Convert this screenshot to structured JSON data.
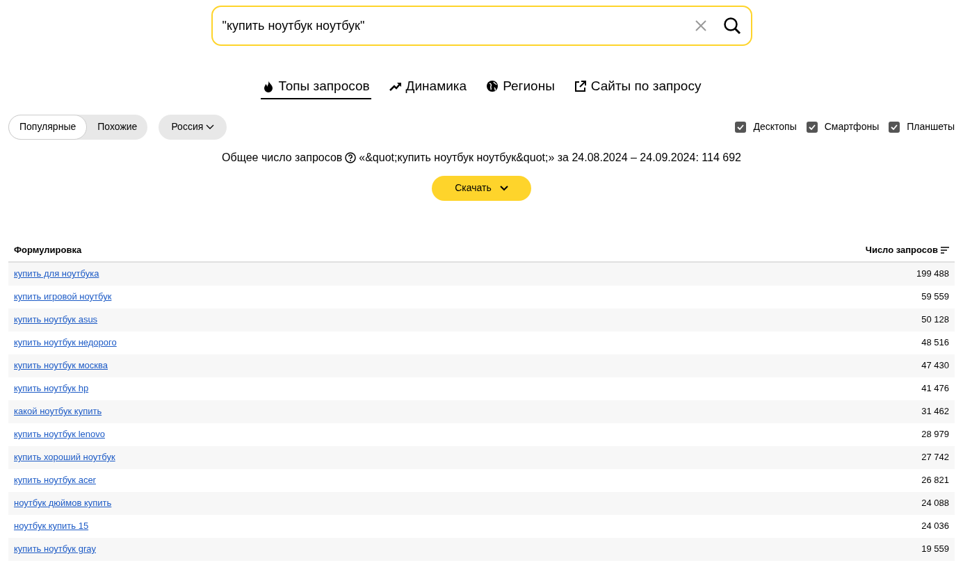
{
  "search": {
    "value": "\"купить ноутбук ноутбук\""
  },
  "tabs": [
    {
      "label": "Топы запросов",
      "kind": "flame",
      "selected": true
    },
    {
      "label": "Динамика",
      "kind": "trend",
      "selected": false
    },
    {
      "label": "Регионы",
      "kind": "globe",
      "selected": false
    },
    {
      "label": "Сайты по запросу",
      "kind": "external",
      "selected": false
    }
  ],
  "mode_switch": [
    {
      "label": "Популярные",
      "selected": true
    },
    {
      "label": "Похожие",
      "selected": false
    }
  ],
  "region_dropdown": {
    "label": "Россия"
  },
  "devices": [
    {
      "label": "Десктопы",
      "checked": true
    },
    {
      "label": "Смартфоны",
      "checked": true
    },
    {
      "label": "Планшеты",
      "checked": true
    }
  ],
  "summary": {
    "label": "Общее число запросов",
    "text": "«&quot;купить ноутбук ноутбук&quot;» за 24.08.2024 – 24.09.2024: 114 692"
  },
  "download_button": {
    "label": "Скачать"
  },
  "table": {
    "columns": [
      "Формулировка",
      "Число запросов"
    ],
    "rows": [
      {
        "phrase": "купить для ноутбука",
        "count": "199 488"
      },
      {
        "phrase": "купить игровой ноутбук",
        "count": "59 559"
      },
      {
        "phrase": "купить ноутбук asus",
        "count": "50 128"
      },
      {
        "phrase": "купить ноутбук недорого",
        "count": "48 516"
      },
      {
        "phrase": "купить ноутбук москва",
        "count": "47 430"
      },
      {
        "phrase": "купить ноутбук hp",
        "count": "41 476"
      },
      {
        "phrase": "какой ноутбук купить",
        "count": "31 462"
      },
      {
        "phrase": "купить ноутбук lenovo",
        "count": "28 979"
      },
      {
        "phrase": "купить хороший ноутбук",
        "count": "27 742"
      },
      {
        "phrase": "купить ноутбук acer",
        "count": "26 821"
      },
      {
        "phrase": "ноутбук дюймов купить",
        "count": "24 088"
      },
      {
        "phrase": "ноутбук купить 15",
        "count": "24 036"
      },
      {
        "phrase": "купить ноутбук gray",
        "count": "19 559"
      }
    ]
  }
}
